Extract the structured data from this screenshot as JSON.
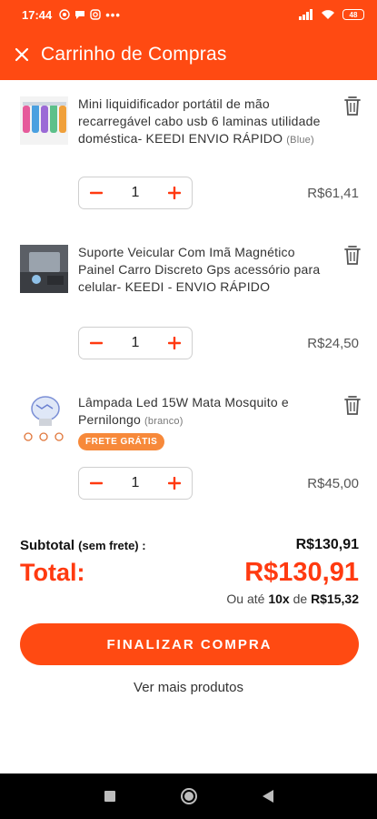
{
  "status_bar": {
    "time": "17:44",
    "battery": "48"
  },
  "header": {
    "title": "Carrinho de Compras"
  },
  "items": [
    {
      "name": "Mini liquidificador portátil de mão recarregável cabo usb 6 laminas utilidade doméstica- KEEDI ENVIO RÁPIDO",
      "variant": "(Blue)",
      "quantity": "1",
      "price": "R$61,41",
      "badge": ""
    },
    {
      "name": "Suporte Veicular Com Imã Magnético Painel Carro Discreto Gps acessório para celular- KEEDI - ENVIO RÁPIDO",
      "variant": "",
      "quantity": "1",
      "price": "R$24,50",
      "badge": ""
    },
    {
      "name": "Lâmpada Led 15W Mata Mosquito e Pernilongo",
      "variant": "(branco)",
      "quantity": "1",
      "price": "R$45,00",
      "badge": "FRETE GRÁTIS"
    }
  ],
  "summary": {
    "subtotal_label": "Subtotal",
    "subtotal_note": "(sem frete) :",
    "subtotal_value": "R$130,91",
    "total_label": "Total:",
    "total_value": "R$130,91",
    "installments_prefix": "Ou até",
    "installments_count": "10x",
    "installments_mid": "de",
    "installments_value": "R$15,32"
  },
  "actions": {
    "checkout_label": "FINALIZAR COMPRA",
    "more_products_label": "Ver mais produtos"
  },
  "colors": {
    "brand": "#ff4a12",
    "total": "#ff3a10",
    "badge": "#f7893a"
  },
  "icons": [
    "close-icon",
    "trash-icon",
    "minus-icon",
    "plus-icon",
    "whatsapp-icon",
    "chat-icon",
    "instagram-icon",
    "signal-icon",
    "wifi-icon",
    "battery-icon",
    "nav-recent-icon",
    "nav-home-icon",
    "nav-back-icon"
  ]
}
